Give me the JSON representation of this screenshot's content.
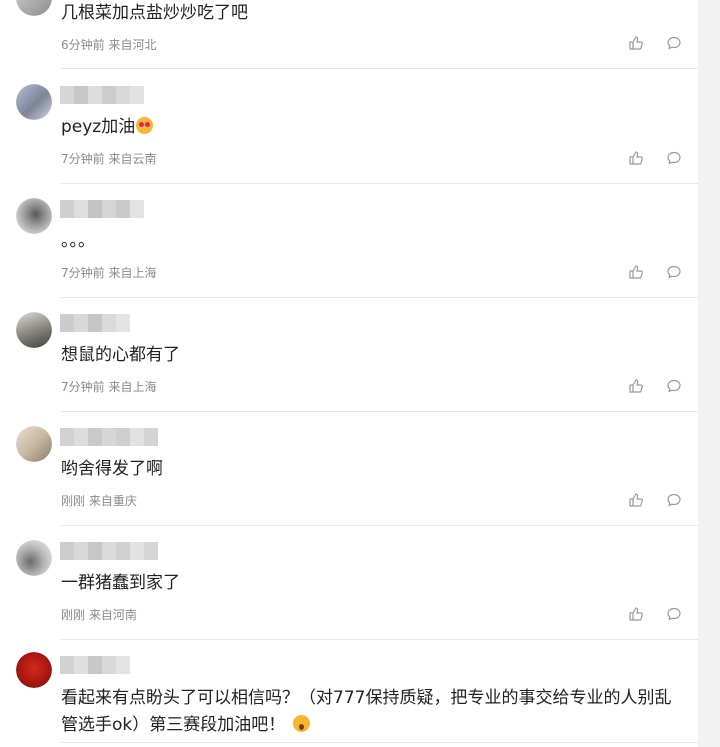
{
  "icons": {
    "like": "thumbs-up-icon",
    "reply": "comment-bubble-icon"
  },
  "colors": {
    "meta_text": "#8a8a8a",
    "divider": "#e8e8e8",
    "icon": "#9a9a9a"
  },
  "comments": [
    {
      "text": "几根菜加点盐炒炒吃了吧",
      "meta": "6分钟前 来自河北"
    },
    {
      "text": "peyz加油",
      "emoji": "heart-eyes-emoji",
      "meta": "7分钟前 来自云南"
    },
    {
      "text": "。。。",
      "meta": "7分钟前 来自上海"
    },
    {
      "text": "想鼠的心都有了",
      "meta": "7分钟前 来自上海"
    },
    {
      "text": "哟舍得发了啊",
      "meta": "刚刚 来自重庆"
    },
    {
      "text": "一群猪蠢到家了",
      "meta": "刚刚 来自河南"
    },
    {
      "text": "看起来有点盼头了可以相信吗？（对777保持质疑，把专业的事交给专业的人别乱管选手ok）第三赛段加油吧！",
      "emoji": "surprised-emoji",
      "meta": ""
    }
  ]
}
